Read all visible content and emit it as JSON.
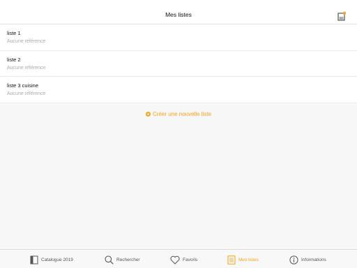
{
  "header": {
    "title": "Mes listes",
    "action_icon": "lists-badge-icon",
    "badge_color": "#f5a218"
  },
  "lists": [
    {
      "name": "liste 1",
      "subtitle": "Aucune référence"
    },
    {
      "name": "liste 2",
      "subtitle": "Aucune référence"
    },
    {
      "name": "liste 3 cuisine",
      "subtitle": "Aucune référence"
    }
  ],
  "create_label": "Créer une nouvelle liste",
  "accent_color": "#f5a218",
  "tabs": [
    {
      "label": "Catalogue 2019",
      "icon": "catalogue-icon",
      "active": false
    },
    {
      "label": "Rechercher",
      "icon": "search-icon",
      "active": false
    },
    {
      "label": "Favoris",
      "icon": "heart-icon",
      "active": false
    },
    {
      "label": "Mes listes",
      "icon": "list-icon",
      "active": true
    },
    {
      "label": "Informations",
      "icon": "info-icon",
      "active": false
    }
  ]
}
